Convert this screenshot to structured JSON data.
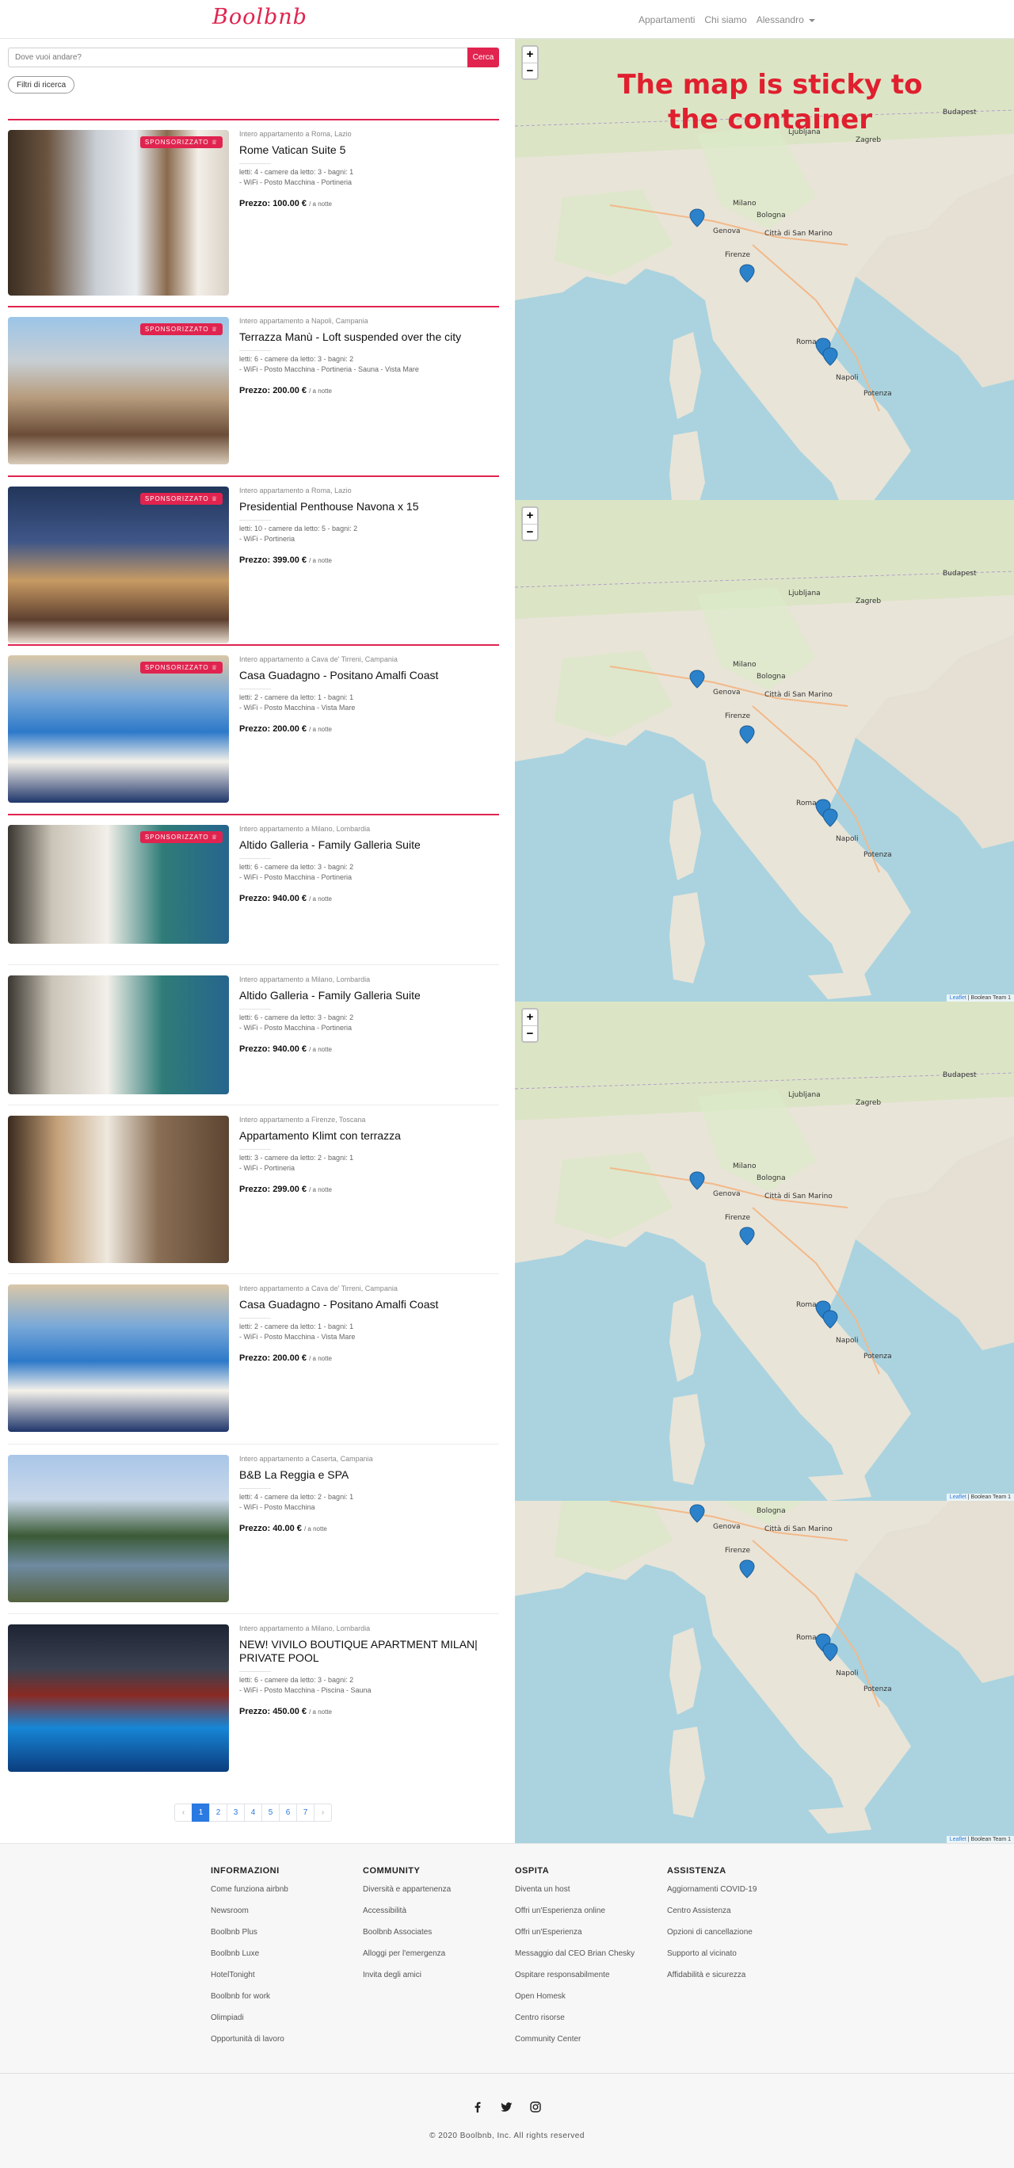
{
  "nav": {
    "logo": "Boolbnb",
    "links": [
      "Appartamenti",
      "Chi siamo"
    ],
    "user": "Alessandro"
  },
  "search": {
    "placeholder": "Dove vuoi andare?",
    "button": "Cerca",
    "filters": "Filtri di ricerca"
  },
  "listings": [
    {
      "location": "Intero appartamento a Roma, Lazio",
      "title": "Rome Vatican Suite 5",
      "features": "letti: 4 - camere da letto: 3 - bagni: 1",
      "services": "- WiFi - Posto Macchina - Portineria",
      "price": "100.00 €",
      "per": "/ a notte",
      "badge": "SPONSORIZZATO"
    },
    {
      "location": "Intero appartamento a Napoli, Campania",
      "title": "Terrazza Manù - Loft suspended over the city",
      "features": "letti: 6 - camere da letto: 3 - bagni: 2",
      "services": "- WiFi - Posto Macchina - Portineria - Sauna - Vista Mare",
      "price": "200.00 €",
      "per": "/ a notte",
      "badge": "SPONSORIZZATO"
    },
    {
      "location": "Intero appartamento a Roma, Lazio",
      "title": "Presidential Penthouse Navona x 15",
      "features": "letti: 10 - camere da letto: 5 - bagni: 2",
      "services": "- WiFi - Portineria",
      "price": "399.00 €",
      "per": "/ a notte",
      "badge": "SPONSORIZZATO"
    },
    {
      "location": "Intero appartamento a Cava de' Tirreni, Campania",
      "title": "Casa Guadagno - Positano Amalfi Coast",
      "features": "letti: 2 - camere da letto: 1 - bagni: 1",
      "services": "- WiFi - Posto Macchina - Vista Mare",
      "price": "200.00 €",
      "per": "/ a notte",
      "badge": "SPONSORIZZATO"
    },
    {
      "location": "Intero appartamento a Milano, Lombardia",
      "title": "Altido Galleria - Family Galleria Suite",
      "features": "letti: 6 - camere da letto: 3 - bagni: 2",
      "services": "- WiFi - Posto Macchina - Portineria",
      "price": "940.00 €",
      "per": "/ a notte",
      "badge": "SPONSORIZZATO"
    },
    {
      "location": "Intero appartamento a Milano, Lombardia",
      "title": "Altido Galleria - Family Galleria Suite",
      "features": "letti: 6 - camere da letto: 3 - bagni: 2",
      "services": "- WiFi - Posto Macchina - Portineria",
      "price": "940.00 €",
      "per": "/ a notte"
    },
    {
      "location": "Intero appartamento a Firenze, Toscana",
      "title": "Appartamento Klimt con terrazza",
      "features": "letti: 3 - camere da letto: 2 - bagni: 1",
      "services": "- WiFi - Portineria",
      "price": "299.00 €",
      "per": "/ a notte"
    },
    {
      "location": "Intero appartamento a Cava de' Tirreni, Campania",
      "title": "Casa Guadagno - Positano Amalfi Coast",
      "features": "letti: 2 - camere da letto: 1 - bagni: 1",
      "services": "- WiFi - Posto Macchina - Vista Mare",
      "price": "200.00 €",
      "per": "/ a notte"
    },
    {
      "location": "Intero appartamento a Caserta, Campania",
      "title": "B&B La Reggia e SPA",
      "features": "letti: 4 - camere da letto: 2 - bagni: 1",
      "services": "- WiFi - Posto Macchina",
      "price": "40.00 €",
      "per": "/ a notte"
    },
    {
      "location": "Intero appartamento a Milano, Lombardia",
      "title": "NEW! VIVILO BOUTIQUE APARTMENT MILAN| PRIVATE POOL",
      "features": "letti: 6 - camere da letto: 3 - bagni: 2",
      "services": "- WiFi - Posto Macchina - Piscina - Sauna",
      "price": "450.00 €",
      "per": "/ a notte"
    }
  ],
  "price_label": "Prezzo:",
  "pagination": {
    "prev": "‹",
    "pages": [
      "1",
      "2",
      "3",
      "4",
      "5",
      "6",
      "7"
    ],
    "next": "›",
    "active": "1"
  },
  "map": {
    "note": "The map is sticky to the container",
    "zoom_in": "+",
    "zoom_out": "−",
    "attribution_link": "Leaflet",
    "attribution_text": " | Boolean Team 1",
    "labels": [
      "Bologna",
      "Firenze",
      "Genova",
      "Roma",
      "Napoli",
      "Milano",
      "Città di San Marino",
      "Zagreb",
      "Budapest",
      "Ljubljana",
      "Potenza"
    ]
  },
  "footer": {
    "columns": [
      {
        "title": "INFORMAZIONI",
        "items": [
          "Come funziona airbnb",
          "Newsroom",
          "Boolbnb Plus",
          "Boolbnb Luxe",
          "HotelTonight",
          "Boolbnb for work",
          "Olimpiadi",
          "Opportunità di lavoro"
        ]
      },
      {
        "title": "COMMUNITY",
        "items": [
          "Diversità e appartenenza",
          "Accessibilità",
          "Boolbnb Associates",
          "Alloggi per l'emergenza",
          "Invita degli amici"
        ]
      },
      {
        "title": "OSPITA",
        "items": [
          "Diventa un host",
          "Offri un'Esperienza online",
          "Offri un'Esperienza",
          "Messaggio dal CEO Brian Chesky",
          "Ospitare responsabilmente",
          "Open Homesk",
          "Centro risorse",
          "Community Center"
        ]
      },
      {
        "title": "ASSISTENZA",
        "items": [
          "Aggiornamenti COVID-19",
          "Centro Assistenza",
          "Opzioni di cancellazione",
          "Supporto al vicinato",
          "Affidabilità e sicurezza"
        ]
      }
    ],
    "copyright": "© 2020 Boolbnb, Inc. All rights reserved"
  }
}
